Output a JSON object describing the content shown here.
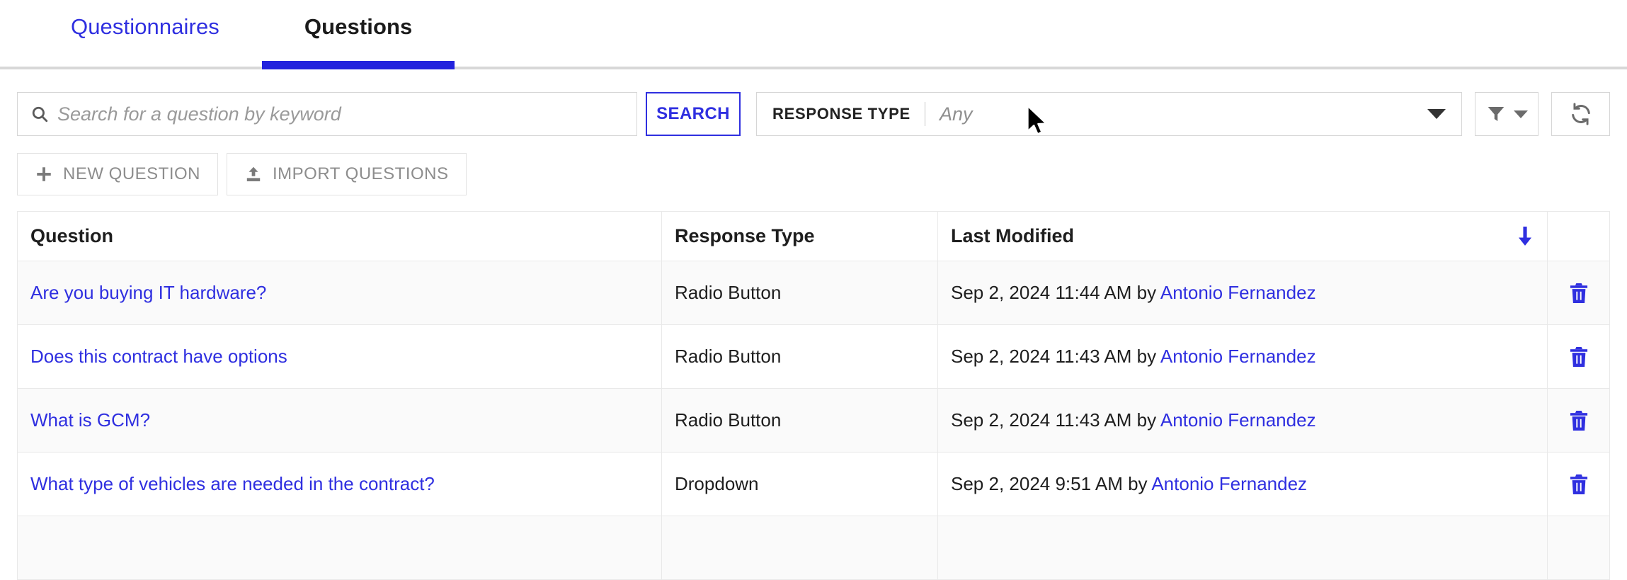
{
  "tabs": [
    {
      "label": "Questionnaires",
      "active": false
    },
    {
      "label": "Questions",
      "active": true
    }
  ],
  "toolbar": {
    "search_placeholder": "Search for a question by keyword",
    "search_value": "",
    "search_button_label": "SEARCH",
    "response_type_label": "RESPONSE TYPE",
    "response_type_value": "Any",
    "filter_icon": "filter-funnel-icon",
    "refresh_icon": "refresh-icon",
    "search_icon": "search-icon"
  },
  "actions": {
    "new_question_label": "NEW QUESTION",
    "new_question_icon": "plus-icon",
    "import_questions_label": "IMPORT QUESTIONS",
    "import_questions_icon": "upload-icon"
  },
  "table": {
    "columns": [
      {
        "label": "Question"
      },
      {
        "label": "Response Type"
      },
      {
        "label": "Last Modified"
      },
      {
        "label": ""
      }
    ],
    "sort": {
      "column": "Last Modified",
      "direction": "descending",
      "icon": "arrow-down-icon"
    },
    "delete_icon": "trash-icon",
    "rows": [
      {
        "question": "Are you buying IT hardware?",
        "response_type": "Radio Button",
        "modified_date": "Sep 2, 2024 11:44 AM by ",
        "modified_by": "Antonio Fernandez"
      },
      {
        "question": "Does this contract have options",
        "response_type": "Radio Button",
        "modified_date": "Sep 2, 2024 11:43 AM by ",
        "modified_by": "Antonio Fernandez"
      },
      {
        "question": "What is GCM?",
        "response_type": "Radio Button",
        "modified_date": "Sep 2, 2024 11:43 AM by ",
        "modified_by": "Antonio Fernandez"
      },
      {
        "question": "What type of vehicles are needed in the contract?",
        "response_type": "Dropdown",
        "modified_date": "Sep 2, 2024 9:51 AM by ",
        "modified_by": "Antonio Fernandez"
      },
      {
        "question": "",
        "response_type": "",
        "modified_date": "",
        "modified_by": ""
      }
    ]
  },
  "colors": {
    "accent": "#2f2fe0",
    "tab_underline": "#2222dd",
    "border": "#e9e9e9",
    "row_alt": "#fafafa"
  }
}
